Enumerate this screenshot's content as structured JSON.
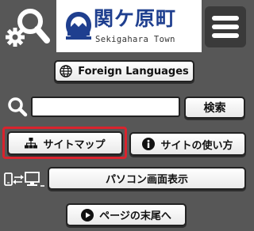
{
  "header": {
    "logo_title": "関ケ原町",
    "logo_subtitle": "Sekigahara Town",
    "search_settings_icon": "search-settings-icon",
    "menu_icon": "hamburger-menu-icon"
  },
  "language_button": {
    "label": "Foreign Languages",
    "icon": "globe-icon"
  },
  "search": {
    "input_value": "",
    "input_placeholder": "",
    "button_label": "検索",
    "icon": "search-icon"
  },
  "nav": {
    "sitemap_label": "サイトマップ",
    "sitemap_icon": "sitemap-icon",
    "howto_label": "サイトの使い方",
    "howto_icon": "info-icon"
  },
  "display": {
    "pc_label": "パソコン画面表示",
    "icon": "device-switch-icon"
  },
  "page_bottom": {
    "label": "ページの末尾へ",
    "icon": "play-icon"
  },
  "colors": {
    "background": "#575757",
    "logo_blue": "#1f3f8f",
    "highlight": "#d9232d"
  }
}
